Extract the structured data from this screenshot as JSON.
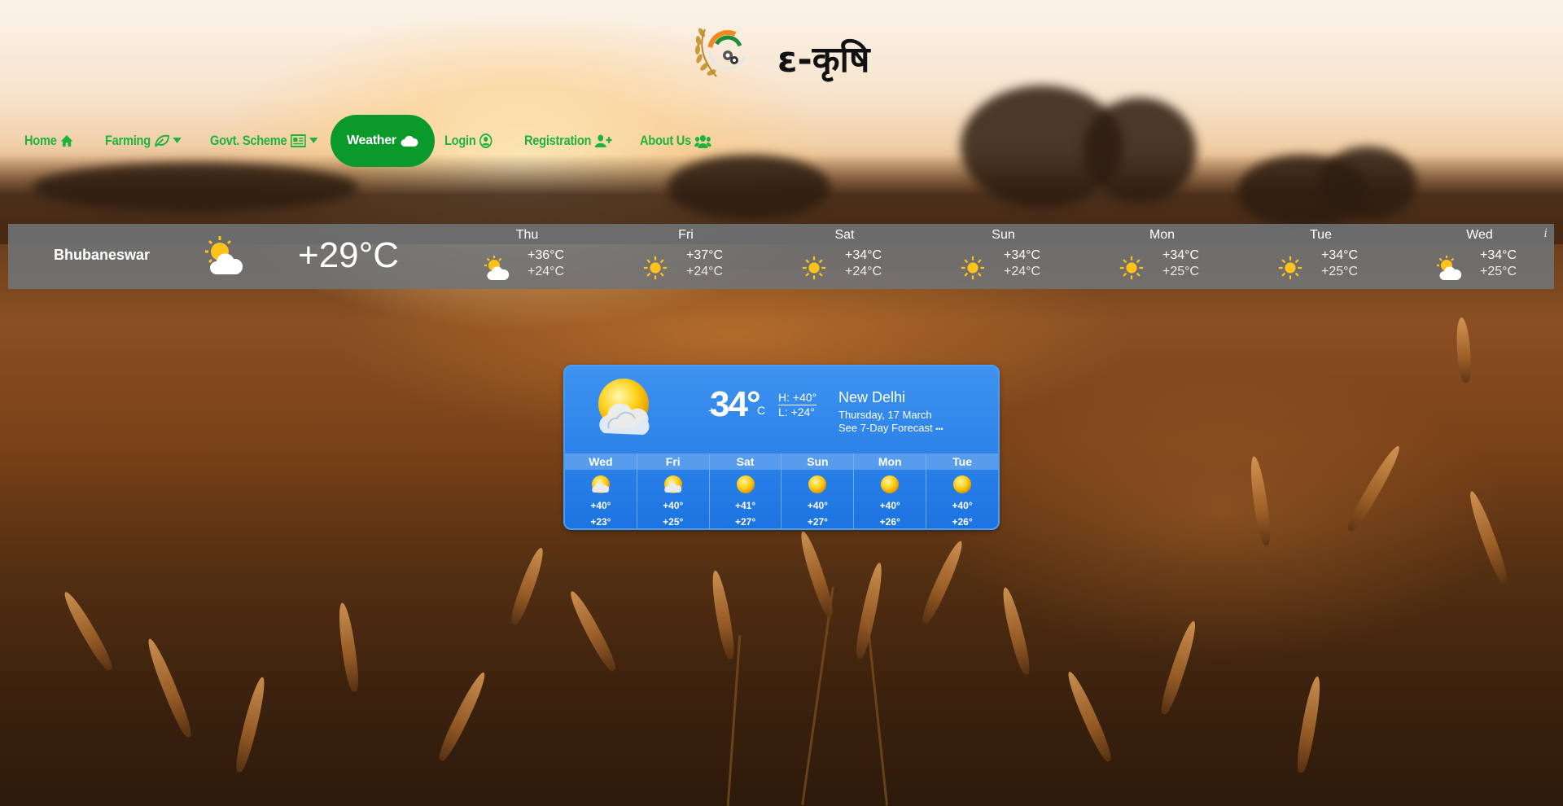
{
  "brand": {
    "name": "ε-कृषि"
  },
  "nav": {
    "items": [
      {
        "label": "Home",
        "icon": "home-icon"
      },
      {
        "label": "Farming",
        "icon": "leaf-icon",
        "dropdown": true
      },
      {
        "label": "Govt. Scheme",
        "icon": "newspaper-icon",
        "dropdown": true
      },
      {
        "label": "Weather",
        "icon": "cloud-icon",
        "active": true
      },
      {
        "label": "Login",
        "icon": "user-circle-icon"
      },
      {
        "label": "Registration",
        "icon": "user-plus-icon"
      },
      {
        "label": "About Us",
        "icon": "users-icon"
      }
    ],
    "colors": {
      "text": "#1db33c",
      "active_bg": "#0a9a2b"
    }
  },
  "strip": {
    "city": "Bhubaneswar",
    "current_temp": "+29°C",
    "current_icon": "partly-cloudy-icon",
    "info": "i",
    "days": [
      {
        "day": "Thu",
        "icon": "partly-cloudy-icon",
        "high": "+36°C",
        "low": "+24°C"
      },
      {
        "day": "Fri",
        "icon": "sun-icon",
        "high": "+37°C",
        "low": "+24°C"
      },
      {
        "day": "Sat",
        "icon": "sun-icon",
        "high": "+34°C",
        "low": "+24°C"
      },
      {
        "day": "Sun",
        "icon": "sun-icon",
        "high": "+34°C",
        "low": "+24°C"
      },
      {
        "day": "Mon",
        "icon": "sun-icon",
        "high": "+34°C",
        "low": "+25°C"
      },
      {
        "day": "Tue",
        "icon": "sun-icon",
        "high": "+34°C",
        "low": "+25°C"
      },
      {
        "day": "Wed",
        "icon": "partly-cloudy-icon",
        "high": "+34°C",
        "low": "+25°C"
      }
    ]
  },
  "widget": {
    "plus": "+",
    "temp": "34°",
    "unit": "C",
    "high": "H: +40°",
    "low": "L: +24°",
    "city": "New Delhi",
    "date": "Thursday, 17 March",
    "link": "See 7-Day Forecast",
    "link_dots": "•••",
    "days": [
      {
        "day": "Wed",
        "icon": "sun-cloud-icon",
        "high": "+40°",
        "low": "+23°"
      },
      {
        "day": "Fri",
        "icon": "sun-cloud-icon",
        "high": "+40°",
        "low": "+25°"
      },
      {
        "day": "Sat",
        "icon": "sun-icon",
        "high": "+41°",
        "low": "+27°"
      },
      {
        "day": "Sun",
        "icon": "sun-icon",
        "high": "+40°",
        "low": "+27°"
      },
      {
        "day": "Mon",
        "icon": "sun-icon",
        "high": "+40°",
        "low": "+26°"
      },
      {
        "day": "Tue",
        "icon": "sun-icon",
        "high": "+40°",
        "low": "+26°"
      }
    ]
  }
}
